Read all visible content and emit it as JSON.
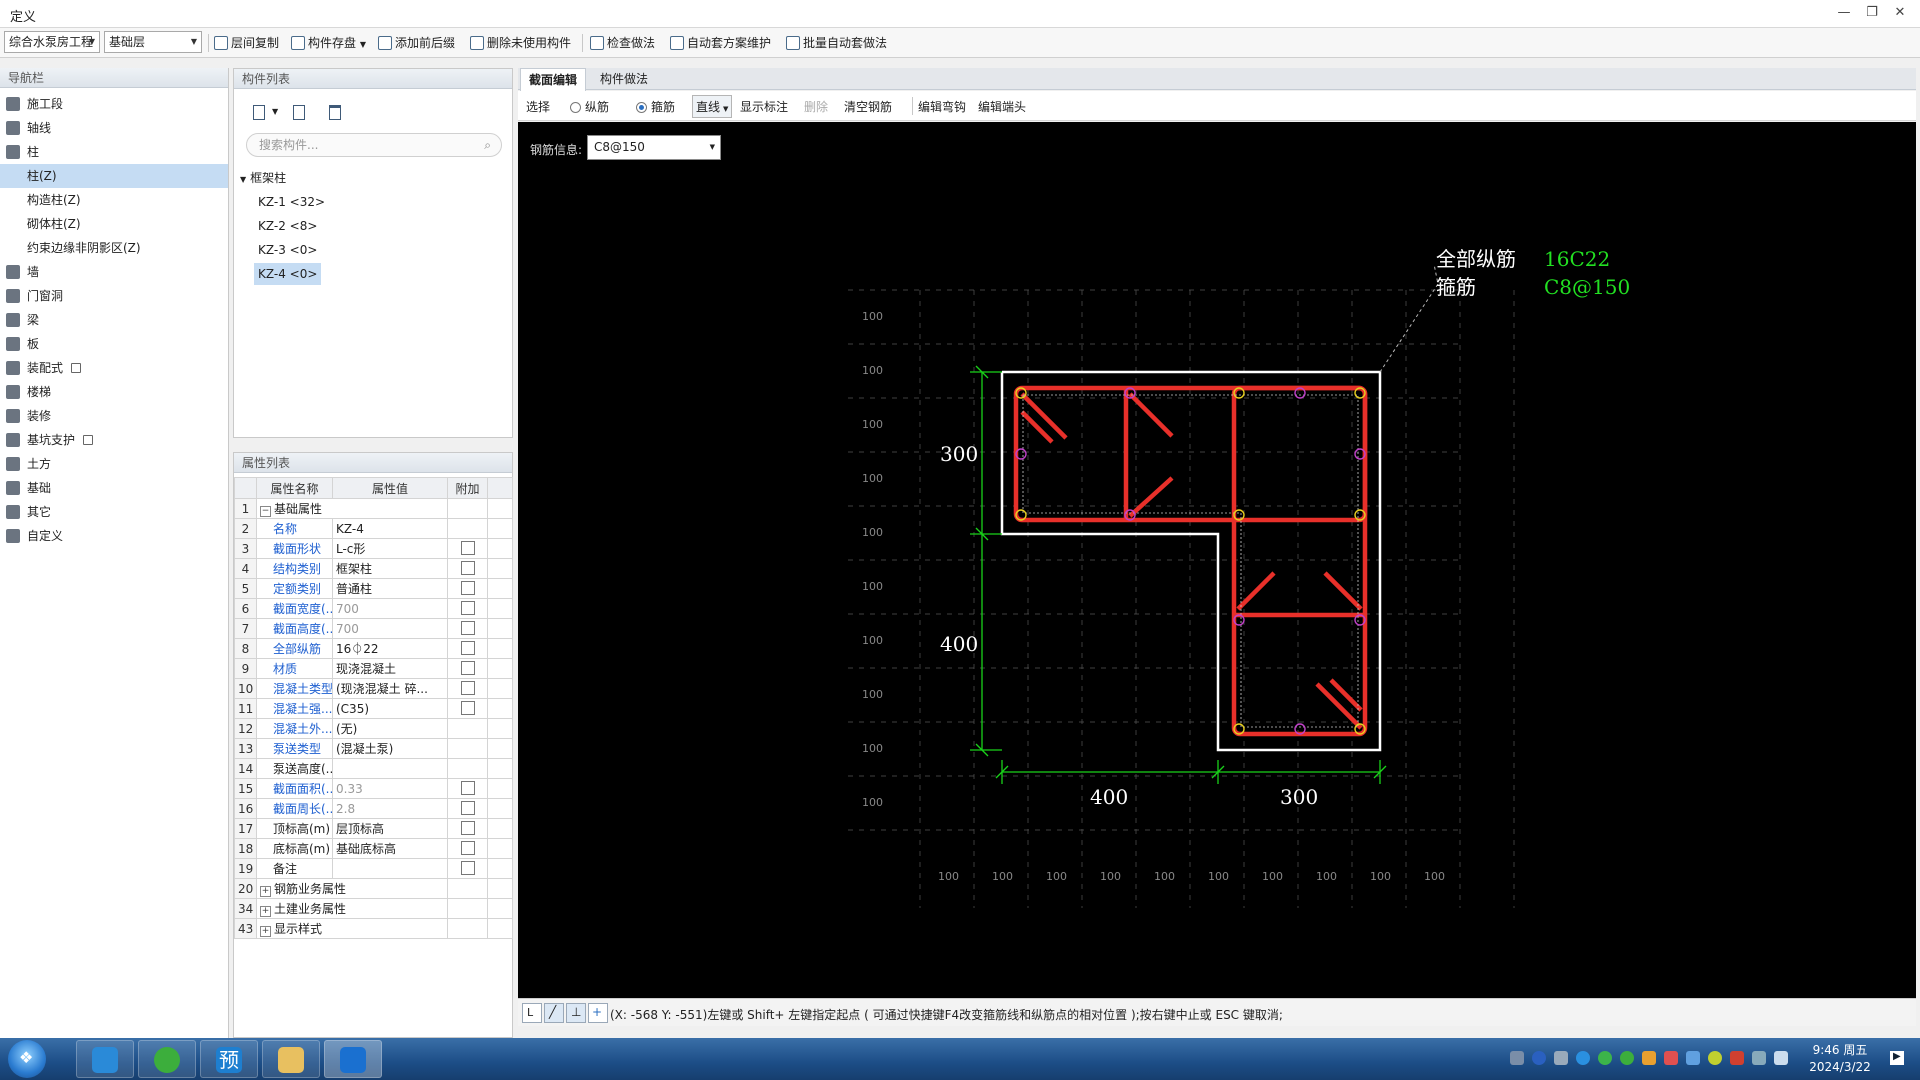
{
  "window": {
    "title": "定义",
    "min": "—",
    "restore": "❐",
    "close": "✕"
  },
  "toolbar": {
    "project_combo": "综合水泵房工程",
    "floor_combo": "基础层",
    "buttons": [
      "层间复制",
      "构件存盘",
      "添加前后缀",
      "删除未使用构件",
      "检查做法",
      "自动套方案维护",
      "批量自动套做法"
    ]
  },
  "nav": {
    "header": "导航栏",
    "items": [
      {
        "label": "施工段"
      },
      {
        "label": "轴线"
      },
      {
        "label": "柱"
      },
      {
        "label": "柱(Z)"
      },
      {
        "label": "构造柱(Z)"
      },
      {
        "label": "砌体柱(Z)"
      },
      {
        "label": "约束边缘非阴影区(Z)"
      },
      {
        "label": "墙"
      },
      {
        "label": "门窗洞"
      },
      {
        "label": "梁"
      },
      {
        "label": "板"
      },
      {
        "label": "装配式"
      },
      {
        "label": "楼梯"
      },
      {
        "label": "装修"
      },
      {
        "label": "基坑支护"
      },
      {
        "label": "土方"
      },
      {
        "label": "基础"
      },
      {
        "label": "其它"
      },
      {
        "label": "自定义"
      }
    ]
  },
  "component_list": {
    "header": "构件列表",
    "search_placeholder": "搜索构件...",
    "group": "框架柱",
    "items": [
      "KZ-1 <32>",
      "KZ-2 <8>",
      "KZ-3 <0>",
      "KZ-4 <0>"
    ]
  },
  "property_list": {
    "header": "属性列表",
    "columns": [
      "",
      "属性名称",
      "属性值",
      "附加"
    ],
    "rows": [
      {
        "n": "1",
        "name": "基础属性",
        "value": ""
      },
      {
        "n": "2",
        "name": "名称",
        "value": "KZ-4"
      },
      {
        "n": "3",
        "name": "截面形状",
        "value": "L-c形"
      },
      {
        "n": "4",
        "name": "结构类别",
        "value": "框架柱"
      },
      {
        "n": "5",
        "name": "定额类别",
        "value": "普通柱"
      },
      {
        "n": "6",
        "name": "截面宽度(...",
        "value": "700"
      },
      {
        "n": "7",
        "name": "截面高度(...",
        "value": "700"
      },
      {
        "n": "8",
        "name": "全部纵筋",
        "value": "16⏀22"
      },
      {
        "n": "9",
        "name": "材质",
        "value": "现浇混凝土"
      },
      {
        "n": "10",
        "name": "混凝土类型",
        "value": "(现浇混凝土  碎..."
      },
      {
        "n": "11",
        "name": "混凝土强...",
        "value": "(C35)"
      },
      {
        "n": "12",
        "name": "混凝土外...",
        "value": "(无)"
      },
      {
        "n": "13",
        "name": "泵送类型",
        "value": "(混凝土泵)"
      },
      {
        "n": "14",
        "name": "泵送高度(...",
        "value": ""
      },
      {
        "n": "15",
        "name": "截面面积(...",
        "value": "0.33"
      },
      {
        "n": "16",
        "name": "截面周长(...",
        "value": "2.8"
      },
      {
        "n": "17",
        "name": "顶标高(m)",
        "value": "层顶标高"
      },
      {
        "n": "18",
        "name": "底标高(m)",
        "value": "基础底标高"
      },
      {
        "n": "19",
        "name": "备注",
        "value": ""
      },
      {
        "n": "20",
        "name": "钢筋业务属性",
        "value": ""
      },
      {
        "n": "34",
        "name": "土建业务属性",
        "value": ""
      },
      {
        "n": "43",
        "name": "显示样式",
        "value": ""
      }
    ]
  },
  "editor": {
    "tabs": [
      "截面编辑",
      "构件做法"
    ],
    "tools": {
      "select": "选择",
      "long_bar": "纵筋",
      "stirrup": "箍筋",
      "line_mode": "直线",
      "show_label": "显示标注",
      "delete": "删除",
      "clear": "清空钢筋",
      "edit_hook": "编辑弯钩",
      "edit_end": "编辑端头"
    },
    "rebar_info_label": "钢筋信息:",
    "rebar_info_value": "C8@150",
    "annotation": {
      "label1": "全部纵筋",
      "value1": "16C22",
      "label2": "箍筋",
      "value2": "C8@150"
    },
    "dims": {
      "left_top": "300",
      "left_bottom": "400",
      "bottom_left": "400",
      "bottom_right": "300"
    },
    "grid_label": "100",
    "status_text": "(X: -568 Y: -551)左键或 Shift+ 左键指定起点 ( 可通过快捷键F4改变箍筋线和纵筋点的相对位置 );按右键中止或 ESC 键取消;"
  },
  "taskbar": {
    "time": "9:46 周五",
    "date": "2024/3/22",
    "preview_app": "预"
  },
  "colors": {
    "rebar": "#e8302a",
    "dimension": "#19d219",
    "annotation_value": "#22e022",
    "outline": "#ffffff",
    "canvas": "#000000",
    "selection": "#c5dcf3",
    "link": "#1e5fd0"
  }
}
